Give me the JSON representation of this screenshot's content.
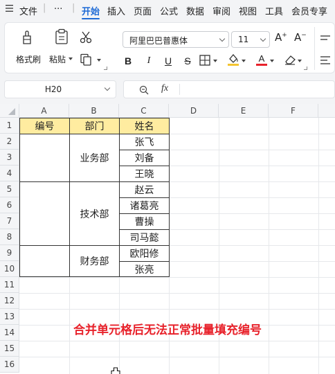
{
  "menubar": {
    "menu_icon": "hamburger-menu-icon",
    "file": "文件",
    "more": "···",
    "tabs": [
      "开始",
      "插入",
      "页面",
      "公式",
      "数据",
      "审阅",
      "视图",
      "工具",
      "会员专享"
    ],
    "active_tab": "开始"
  },
  "ribbon": {
    "format_painter": "格式刷",
    "paste": "粘贴",
    "font_name": "阿里巴巴普惠体",
    "font_size": "11",
    "bold": "B",
    "italic": "I",
    "underline": "U",
    "strike": "S",
    "font_color_accent": "#e8222b",
    "fill_color_accent": "#f4c430"
  },
  "formula_bar": {
    "name_box": "H20",
    "fx": "fx",
    "formula": ""
  },
  "columns": [
    "A",
    "B",
    "C",
    "D",
    "E",
    "F"
  ],
  "rows": [
    "1",
    "2",
    "3",
    "4",
    "5",
    "6",
    "7",
    "8",
    "9",
    "10",
    "11",
    "12",
    "13",
    "14",
    "15",
    "16"
  ],
  "table": {
    "headers": [
      "编号",
      "部门",
      "姓名"
    ],
    "departments": [
      "业务部",
      "技术部",
      "财务部"
    ],
    "names": [
      "张飞",
      "刘备",
      "王晓",
      "赵云",
      "诸葛亮",
      "曹操",
      "司马懿",
      "欧阳修",
      "张亮"
    ]
  },
  "notice": "合并单元格后无法正常批量填充编号",
  "colors": {
    "accent": "#1f6bd6",
    "header_fill": "#ffeca0",
    "notice": "#e8222b"
  }
}
